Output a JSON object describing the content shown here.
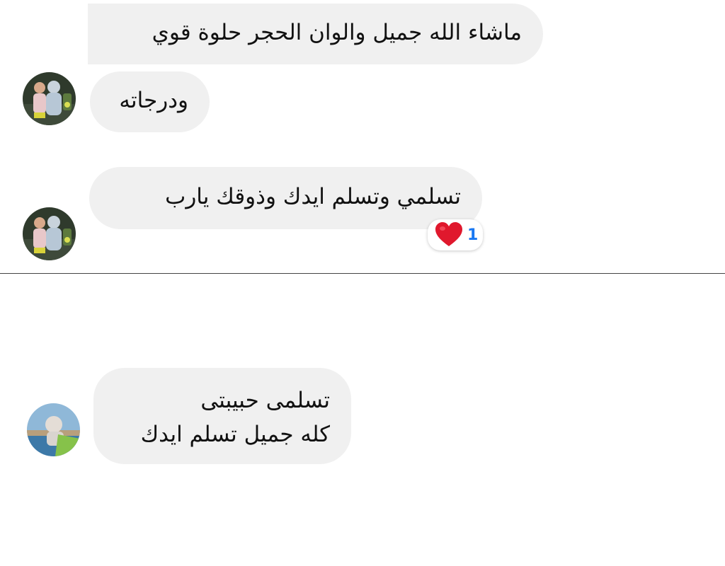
{
  "thread_top": {
    "messages": [
      {
        "text": "ماشاء الله جميل والوان الحجر حلوة قوي"
      },
      {
        "text": "ودرجاته"
      },
      {
        "text": "تسلمي وتسلم ايدك وذوقك يارب",
        "reaction": {
          "icon": "heart-icon",
          "count": "1"
        }
      }
    ]
  },
  "thread_bottom": {
    "messages": [
      {
        "lines": [
          "تسلمى حبيبتى",
          "كله جميل تسلم ايدك"
        ]
      }
    ]
  },
  "colors": {
    "bubble": "#f0f0f0",
    "text": "#111111",
    "reaction_count": "#1877f2",
    "heart": "#e0182d"
  }
}
